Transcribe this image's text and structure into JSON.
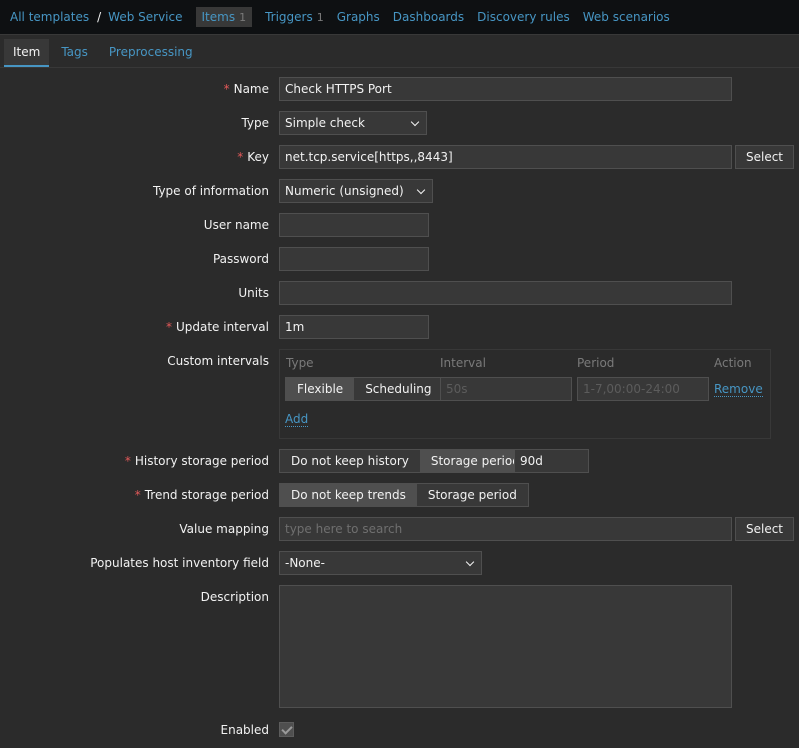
{
  "nav": {
    "breadcrumb_all": "All templates",
    "breadcrumb_sep": "/",
    "breadcrumb_template": "Web Service",
    "items": "Items",
    "items_count": "1",
    "triggers": "Triggers",
    "triggers_count": "1",
    "graphs": "Graphs",
    "dashboards": "Dashboards",
    "discovery": "Discovery rules",
    "web": "Web scenarios"
  },
  "tabs": {
    "item": "Item",
    "tags": "Tags",
    "preprocessing": "Preprocessing"
  },
  "form": {
    "name_label": "Name",
    "name_value": "Check HTTPS Port",
    "type_label": "Type",
    "type_value": "Simple check",
    "key_label": "Key",
    "key_value": "net.tcp.service[https,,8443]",
    "key_select": "Select",
    "info_label": "Type of information",
    "info_value": "Numeric (unsigned)",
    "user_label": "User name",
    "user_value": "",
    "password_label": "Password",
    "password_value": "",
    "units_label": "Units",
    "units_value": "",
    "interval_label": "Update interval",
    "interval_value": "1m",
    "custom_label": "Custom intervals",
    "custom": {
      "col_type": "Type",
      "col_interval": "Interval",
      "col_period": "Period",
      "col_action": "Action",
      "flexible": "Flexible",
      "scheduling": "Scheduling",
      "interval_value": "50s",
      "period_value": "1-7,00:00-24:00",
      "remove": "Remove",
      "add": "Add"
    },
    "history_label": "History storage period",
    "history_no": "Do not keep history",
    "history_storage": "Storage period",
    "history_value": "90d",
    "trend_label": "Trend storage period",
    "trend_no": "Do not keep trends",
    "trend_storage": "Storage period",
    "mapping_label": "Value mapping",
    "mapping_placeholder": "type here to search",
    "mapping_select": "Select",
    "inventory_label": "Populates host inventory field",
    "inventory_value": "-None-",
    "description_label": "Description",
    "description_value": "",
    "enabled_label": "Enabled",
    "enabled": true
  },
  "colors": {
    "link": "#4796c4",
    "required": "#e45959",
    "panel": "#2b2b2b",
    "input": "#383838"
  }
}
